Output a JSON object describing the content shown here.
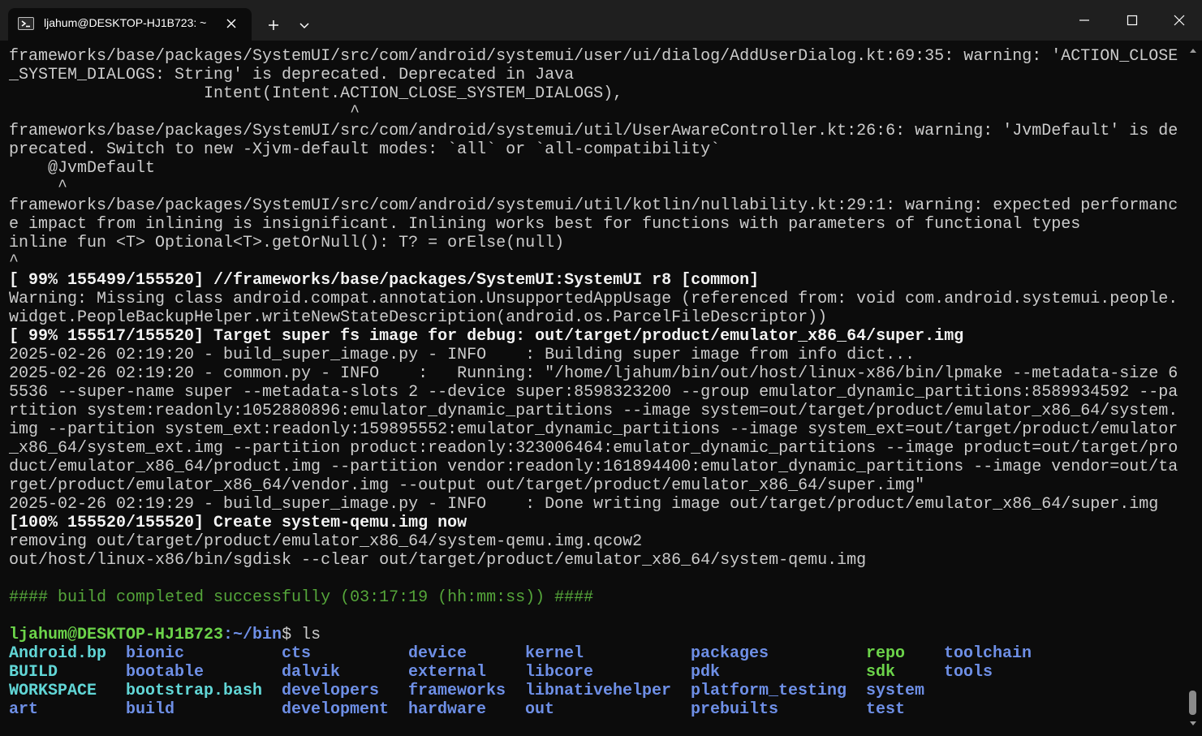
{
  "window": {
    "tab_title": "ljahum@DESKTOP-HJ1B723: ~"
  },
  "icons": {
    "tab": "powershell-icon",
    "close": "close-icon",
    "new_tab": "plus-icon",
    "dropdown": "chevron-down-icon",
    "minimize": "minimize-icon",
    "maximize": "maximize-icon",
    "window_close": "close-icon"
  },
  "colors": {
    "background": "#0c0c0c",
    "titlebar": "#1f1f1f",
    "text": "#cccccc",
    "success_green": "#55a63a",
    "prompt_user": "#6cd44a",
    "prompt_path": "#6e8fe6",
    "ls_file": "#61d6d6",
    "ls_dir": "#6e8fe6"
  },
  "terminal": {
    "lines": [
      "frameworks/base/packages/SystemUI/src/com/android/systemui/user/ui/dialog/AddUserDialog.kt:69:35: warning: 'ACTION_CLOSE",
      "_SYSTEM_DIALOGS: String' is deprecated. Deprecated in Java",
      "                    Intent(Intent.ACTION_CLOSE_SYSTEM_DIALOGS),",
      "                                   ^",
      "frameworks/base/packages/SystemUI/src/com/android/systemui/util/UserAwareController.kt:26:6: warning: 'JvmDefault' is de",
      "precated. Switch to new -Xjvm-default modes: `all` or `all-compatibility`",
      "    @JvmDefault",
      "     ^",
      "frameworks/base/packages/SystemUI/src/com/android/systemui/util/kotlin/nullability.kt:29:1: warning: expected performanc",
      "e impact from inlining is insignificant. Inlining works best for functions with parameters of functional types",
      "inline fun <T> Optional<T>.getOrNull(): T? = orElse(null)",
      "^",
      "[ 99% 155499/155520] //frameworks/base/packages/SystemUI:SystemUI r8 [common]",
      "Warning: Missing class android.compat.annotation.UnsupportedAppUsage (referenced from: void com.android.systemui.people.",
      "widget.PeopleBackupHelper.writeNewStateDescription(android.os.ParcelFileDescriptor))",
      "[ 99% 155517/155520] Target super fs image for debug: out/target/product/emulator_x86_64/super.img",
      "2025-02-26 02:19:20 - build_super_image.py - INFO    : Building super image from info dict...",
      "2025-02-26 02:19:20 - common.py - INFO    :   Running: \"/home/ljahum/bin/out/host/linux-x86/bin/lpmake --metadata-size 6",
      "5536 --super-name super --metadata-slots 2 --device super:8598323200 --group emulator_dynamic_partitions:8589934592 --pa",
      "rtition system:readonly:1052880896:emulator_dynamic_partitions --image system=out/target/product/emulator_x86_64/system.",
      "img --partition system_ext:readonly:159895552:emulator_dynamic_partitions --image system_ext=out/target/product/emulator",
      "_x86_64/system_ext.img --partition product:readonly:323006464:emulator_dynamic_partitions --image product=out/target/pro",
      "duct/emulator_x86_64/product.img --partition vendor:readonly:161894400:emulator_dynamic_partitions --image vendor=out/ta",
      "rget/product/emulator_x86_64/vendor.img --output out/target/product/emulator_x86_64/super.img\"",
      "2025-02-26 02:19:29 - build_super_image.py - INFO    : Done writing image out/target/product/emulator_x86_64/super.img",
      "[100% 155520/155520] Create system-qemu.img now",
      "removing out/target/product/emulator_x86_64/system-qemu.img.qcow2",
      "out/host/linux-x86/bin/sgdisk --clear out/target/product/emulator_x86_64/system-qemu.img",
      "",
      "#### build completed successfully (03:17:19 (hh:mm:ss)) ####",
      ""
    ],
    "prompt": {
      "user": "ljahum@DESKTOP-HJ1B723",
      "path": ":~/bin",
      "symbol": "$ ",
      "command": "ls"
    },
    "ls_columns": [
      [
        "Android.bp",
        "BUILD",
        "WORKSPACE",
        "art"
      ],
      [
        "bionic",
        "bootable",
        "bootstrap.bash",
        "build"
      ],
      [
        "cts",
        "dalvik",
        "developers",
        "development"
      ],
      [
        "device",
        "external",
        "frameworks",
        "hardware"
      ],
      [
        "kernel",
        "libcore",
        "libnativehelper",
        "out"
      ],
      [
        "packages",
        "pdk",
        "platform_testing",
        "prebuilts"
      ],
      [
        "repo",
        "sdk",
        "system",
        "test"
      ],
      [
        "toolchain",
        "tools"
      ]
    ]
  }
}
